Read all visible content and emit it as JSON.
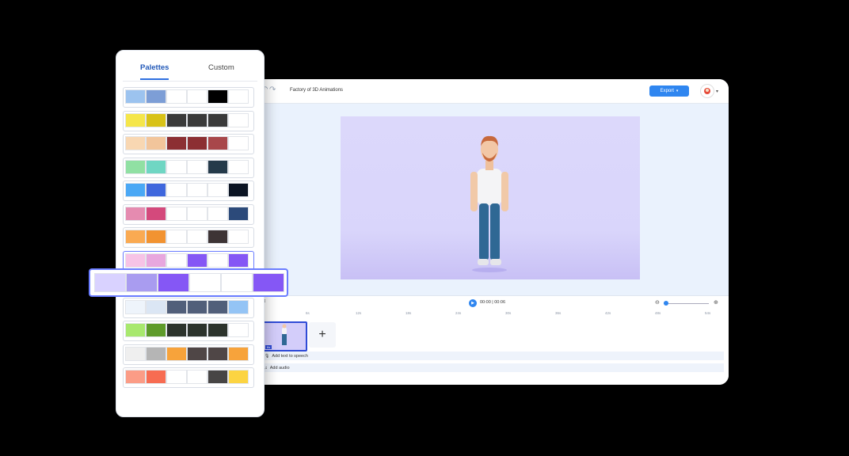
{
  "editor": {
    "project_title": "Factory of 3D Animations",
    "export_label": "Export",
    "time_display": "00:00 | 00:06",
    "ruler_ticks": [
      "6s",
      "12s",
      "18s",
      "24s",
      "30s",
      "36s",
      "42s",
      "48s",
      "54s"
    ],
    "clip_badge": "6s",
    "add_scene_symbol": "+",
    "tracks": {
      "text_to_speech": "Add text to speech",
      "audio": "Add audio"
    },
    "accent_color": "#2f86f0"
  },
  "palette_panel": {
    "tabs": [
      {
        "label": "Palettes",
        "active": true
      },
      {
        "label": "Custom",
        "active": false
      }
    ],
    "palettes": [
      [
        "#9cc3ef",
        "#7d9ed6",
        "#ffffff",
        "#ffffff",
        "#000000",
        "#ffffff"
      ],
      [
        "#f5e64a",
        "#d8c217",
        "#3a3a3a",
        "#3a3a3a",
        "#3a3a3a",
        "#ffffff"
      ],
      [
        "#f8d7b2",
        "#f2c59b",
        "#8c2f33",
        "#8c2f33",
        "#a8474a",
        "#ffffff"
      ],
      [
        "#90e0a3",
        "#6fd6c3",
        "#ffffff",
        "#ffffff",
        "#253a4a",
        "#ffffff"
      ],
      [
        "#4aa8f5",
        "#3f67dd",
        "#ffffff",
        "#ffffff",
        "#ffffff",
        "#0b1423"
      ],
      [
        "#e58bb0",
        "#d4497c",
        "#ffffff",
        "#ffffff",
        "#ffffff",
        "#2c4a7a"
      ],
      [
        "#faaa52",
        "#f29331",
        "#ffffff",
        "#ffffff",
        "#3d3435",
        "#ffffff"
      ],
      [
        "#f7c3e6",
        "#e8a7de",
        "#ffffff",
        "#8557f5",
        "#ffffff",
        "#8557f5"
      ],
      [
        "#fdeeb0",
        "#fdc85e",
        "#4b5058",
        "#4b5058",
        "#4b5058",
        "#ffffff"
      ],
      [
        "#eef4fb",
        "#dbe6f4",
        "#515f7a",
        "#515f7a",
        "#515f7a",
        "#94c4f5"
      ],
      [
        "#a8e86e",
        "#5e9b2a",
        "#2c332c",
        "#2c332c",
        "#2c332c",
        "#ffffff"
      ],
      [
        "#efefef",
        "#b5b5b5",
        "#f7a33b",
        "#4f4646",
        "#4f4646",
        "#f7a33b"
      ],
      [
        "#fb9c86",
        "#f76c52",
        "#ffffff",
        "#ffffff",
        "#474545",
        "#fcd442"
      ]
    ],
    "active_index": 7
  },
  "palette_zoom": {
    "swatches": [
      "#d9d2ff",
      "#a99cf0",
      "#8557f5",
      "#ffffff",
      "#ffffff",
      "#8557f5"
    ]
  }
}
